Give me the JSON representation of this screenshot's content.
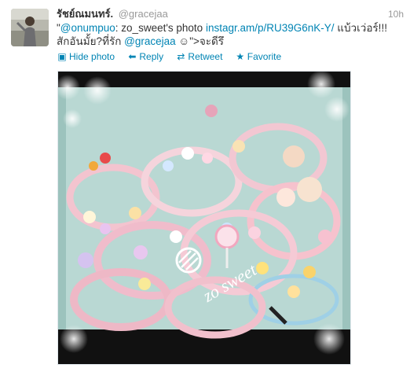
{
  "tweet": {
    "fullname": "รัชย์ณมนทร์.",
    "username": "@gracejaa",
    "time": "10h",
    "text": {
      "q_open": "\"",
      "mention1": "@onumpuo",
      "part1": ": zo_sweet's photo ",
      "link": "instagr.am/p/RU39G6nK-Y/",
      "part2": " แบ้วเว่อร์!!! สักอันมั้ย?ที่รัก ",
      "mention2": "@gracejaa",
      "part3": " ☺\">จะดีรึ"
    },
    "actions": {
      "hide_photo": "Hide photo",
      "reply": "Reply",
      "retweet": "Retweet",
      "favorite": "Favorite"
    },
    "photo": {
      "watermark": "zo sweet"
    }
  },
  "colors": {
    "link": "#0084b4",
    "name": "#333333",
    "meta": "#999999",
    "photo_bg": "#b9d8d3"
  },
  "icons": {
    "hide_photo": "photo-icon",
    "reply": "reply-arrow-icon",
    "retweet": "retweet-arrows-icon",
    "favorite": "star-icon"
  }
}
